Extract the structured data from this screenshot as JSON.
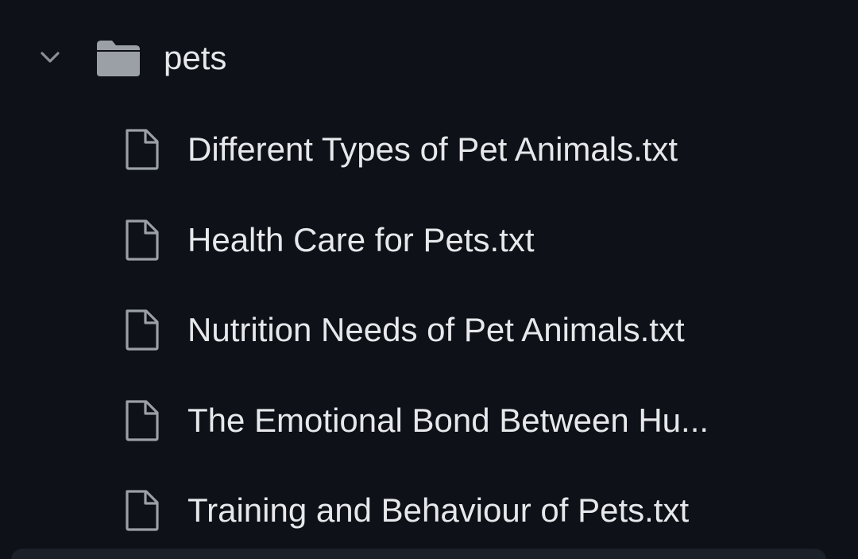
{
  "explorer": {
    "folder": {
      "name": "pets",
      "expanded": true,
      "chevron_icon": "chevron-down-icon",
      "icon": "folder-icon"
    },
    "files": [
      {
        "name": "Different Types of Pet Animals.txt",
        "icon": "file-icon"
      },
      {
        "name": "Health Care for Pets.txt",
        "icon": "file-icon"
      },
      {
        "name": "Nutrition Needs of Pet Animals.txt",
        "icon": "file-icon"
      },
      {
        "name": "The Emotional Bond Between Hu...",
        "icon": "file-icon"
      },
      {
        "name": "Training and Behaviour of Pets.txt",
        "icon": "file-icon"
      }
    ]
  },
  "colors": {
    "background": "#0e1117",
    "text": "#e6e8eb",
    "icon": "#9aa0a6"
  }
}
